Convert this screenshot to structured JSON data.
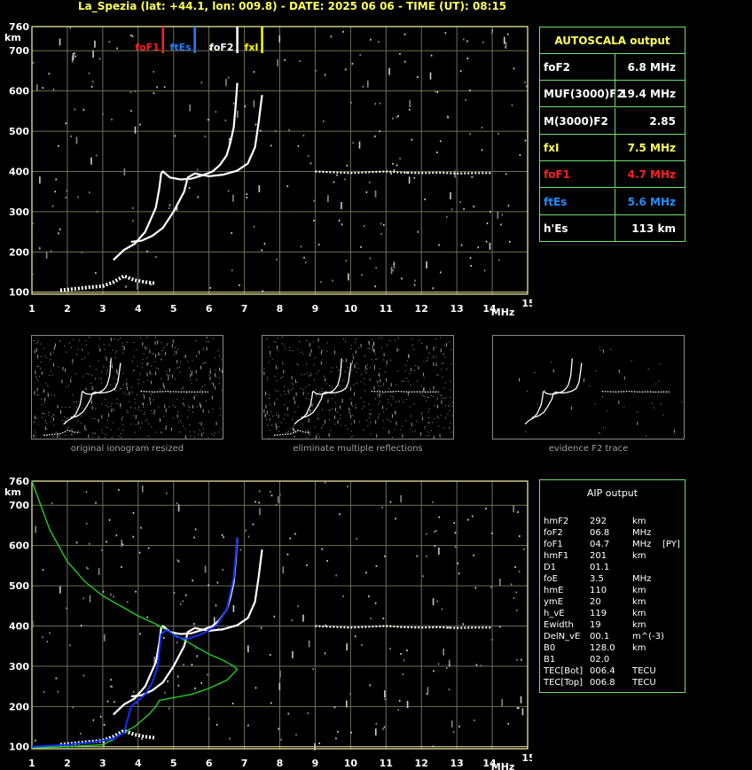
{
  "header": {
    "title": "La_Spezia (lat: +44.1, lon: 009.8) - DATE: 2025 06 06 - TIME (UT): 08:15"
  },
  "colors": {
    "grid": "#e8e8a0",
    "trace": "#ffffff",
    "foF1": "#ff2020",
    "ftEs": "#2080ff",
    "foF2": "#ffffff",
    "fxI": "#ffff00",
    "profile": "#22cc22",
    "aip_trace": "#1030ff",
    "panel_border": "#70e070",
    "label_yellow": "#ffff55"
  },
  "ionogram_top": {
    "y_unit": "km",
    "x_unit": "MHz",
    "y_ticks": [
      "100",
      "200",
      "300",
      "400",
      "500",
      "600",
      "700",
      "760"
    ],
    "x_ticks": [
      "1",
      "2",
      "3",
      "4",
      "5",
      "6",
      "7",
      "8",
      "9",
      "10",
      "11",
      "12",
      "13",
      "14",
      "15"
    ],
    "markers": [
      {
        "label": "foF1",
        "freq": 4.7,
        "color": "#ff2020"
      },
      {
        "label": "ftEs",
        "freq": 5.6,
        "color": "#2080ff"
      },
      {
        "label": "foF2",
        "freq": 6.8,
        "color": "#ffffff"
      },
      {
        "label": "fxI",
        "freq": 7.5,
        "color": "#ffff00"
      }
    ]
  },
  "ionogram_bottom": {
    "y_unit": "km",
    "x_unit": "MHz",
    "y_ticks": [
      "100",
      "200",
      "300",
      "400",
      "500",
      "600",
      "700",
      "760"
    ],
    "x_ticks": [
      "1",
      "2",
      "3",
      "4",
      "5",
      "6",
      "7",
      "8",
      "9",
      "10",
      "11",
      "12",
      "13",
      "14",
      "15"
    ]
  },
  "thumbnails": [
    {
      "caption": "original ionogram resized"
    },
    {
      "caption": "eliminate multiple reflections"
    },
    {
      "caption": "evidence F2 trace"
    }
  ],
  "autoscala": {
    "title": "AUTOSCALA output",
    "rows": [
      {
        "label": "foF2",
        "value": "6.8 MHz",
        "color": "#ffffff"
      },
      {
        "label": "MUF(3000)F2",
        "value": "19.4 MHz",
        "color": "#ffffff"
      },
      {
        "label": "M(3000)F2",
        "value": "2.85",
        "color": "#ffffff"
      },
      {
        "label": "fxI",
        "value": "7.5 MHz",
        "color": "#ffff55"
      },
      {
        "label": "foF1",
        "value": "4.7 MHz",
        "color": "#ff2020"
      },
      {
        "label": "ftEs",
        "value": "5.6 MHz",
        "color": "#2090ff"
      },
      {
        "label": "h'Es",
        "value": "113    km",
        "color": "#ffffff"
      }
    ]
  },
  "aip": {
    "title": "AIP output",
    "rows": [
      {
        "name": "hmF2",
        "value": "292",
        "unit": "km",
        "extra": ""
      },
      {
        "name": "foF2",
        "value": "06.8",
        "unit": "MHz",
        "extra": ""
      },
      {
        "name": "foF1",
        "value": "04.7",
        "unit": "MHz",
        "extra": "[PY]"
      },
      {
        "name": "hmF1",
        "value": "201",
        "unit": "km",
        "extra": ""
      },
      {
        "name": "D1",
        "value": "01.1",
        "unit": "",
        "extra": ""
      },
      {
        "name": "foE",
        "value": "3.5",
        "unit": "MHz",
        "extra": ""
      },
      {
        "name": "hmE",
        "value": "110",
        "unit": "km",
        "extra": ""
      },
      {
        "name": "ymE",
        "value": "20",
        "unit": "km",
        "extra": ""
      },
      {
        "name": "h_vE",
        "value": "119",
        "unit": "km",
        "extra": ""
      },
      {
        "name": "Ewidth",
        "value": "19",
        "unit": "km",
        "extra": ""
      },
      {
        "name": "DelN_vE",
        "value": "00.1",
        "unit": "m^(-3)",
        "extra": ""
      },
      {
        "name": "B0",
        "value": "128.0",
        "unit": "km",
        "extra": ""
      },
      {
        "name": "B1",
        "value": "02.0",
        "unit": "",
        "extra": ""
      },
      {
        "name": "TEC[Bot]",
        "value": "006.4",
        "unit": "TECU",
        "extra": ""
      },
      {
        "name": "TEC[Top]",
        "value": "006.8",
        "unit": "TECU",
        "extra": ""
      }
    ]
  },
  "chart_data": [
    {
      "type": "scatter",
      "name_role": "top ionogram (virtual height vs frequency)",
      "xlabel": "MHz",
      "ylabel": "km",
      "xlim": [
        1,
        15
      ],
      "ylim": [
        95,
        760
      ],
      "grid": true,
      "series": [
        {
          "name": "O-trace",
          "x": [
            3.3,
            3.6,
            3.9,
            4.2,
            4.5,
            4.6,
            4.65,
            4.7,
            4.9,
            5.2,
            5.5,
            5.8,
            6.1,
            6.3,
            6.5,
            6.6,
            6.7,
            6.75,
            6.8
          ],
          "y": [
            180,
            205,
            220,
            250,
            310,
            360,
            395,
            400,
            385,
            380,
            382,
            390,
            400,
            415,
            440,
            470,
            510,
            560,
            620
          ]
        },
        {
          "name": "X-trace",
          "x": [
            3.8,
            4.1,
            4.4,
            4.7,
            5.0,
            5.3,
            5.4,
            5.6,
            6.0,
            6.4,
            6.8,
            7.1,
            7.3,
            7.4,
            7.5
          ],
          "y": [
            225,
            228,
            240,
            260,
            300,
            350,
            385,
            395,
            388,
            392,
            402,
            420,
            460,
            520,
            590
          ]
        },
        {
          "name": "Es-trace",
          "x": [
            1.8,
            2.2,
            2.6,
            3.0,
            3.3,
            3.6,
            3.9,
            4.2,
            4.5
          ],
          "y": [
            105,
            108,
            112,
            115,
            125,
            140,
            130,
            125,
            122
          ]
        },
        {
          "name": "F-multiple",
          "x": [
            9.0,
            9.5,
            10.0,
            10.5,
            11.0,
            11.5,
            12.0,
            12.5,
            13.0,
            13.5,
            14.0
          ],
          "y": [
            400,
            398,
            396,
            398,
            400,
            397,
            396,
            397,
            395,
            396,
            396
          ]
        }
      ],
      "markers": {
        "foF1": 4.7,
        "ftEs": 5.6,
        "foF2": 6.8,
        "fxI": 7.5
      }
    },
    {
      "type": "line",
      "name_role": "bottom ionogram with AIP profile",
      "xlabel": "MHz",
      "ylabel": "km",
      "xlim": [
        1,
        15
      ],
      "ylim": [
        95,
        760
      ],
      "grid": true,
      "series": [
        {
          "name": "profile",
          "x": [
            1.0,
            1.5,
            2.0,
            2.5,
            3.0,
            3.5,
            4.0,
            4.5,
            5.0,
            5.5,
            6.0,
            6.4,
            6.7,
            6.8,
            6.5,
            6.0,
            5.5,
            5.0,
            4.6,
            4.5,
            4.3,
            3.9,
            3.5,
            3.3,
            3.0,
            2.0,
            1.0
          ],
          "y": [
            760,
            640,
            560,
            510,
            475,
            450,
            425,
            405,
            380,
            355,
            330,
            315,
            300,
            292,
            265,
            245,
            230,
            222,
            215,
            200,
            180,
            150,
            130,
            118,
            105,
            100,
            97
          ]
        },
        {
          "name": "aip-trace",
          "x": [
            1.0,
            2.0,
            2.8,
            3.3,
            3.6,
            3.8,
            4.0,
            4.2,
            4.4,
            4.55,
            4.65,
            4.8,
            5.1,
            5.4,
            5.8,
            6.2,
            6.5,
            6.7,
            6.8
          ],
          "y": [
            100,
            105,
            112,
            120,
            135,
            200,
            215,
            230,
            260,
            300,
            380,
            390,
            372,
            368,
            380,
            400,
            440,
            520,
            620
          ]
        }
      ]
    }
  ]
}
